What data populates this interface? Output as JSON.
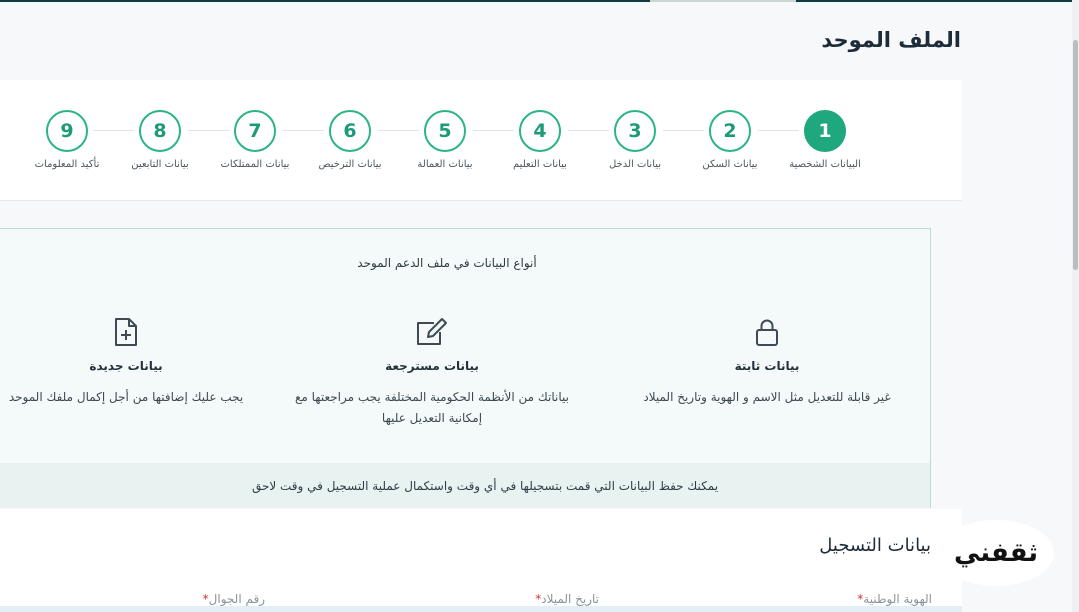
{
  "page": {
    "title": "الملف الموحد"
  },
  "stepper": {
    "steps": [
      {
        "number": "1",
        "label": "البيانات الشخصية",
        "active": true
      },
      {
        "number": "2",
        "label": "بيانات السكن"
      },
      {
        "number": "3",
        "label": "بيانات الدخل"
      },
      {
        "number": "4",
        "label": "بيانات التعليم"
      },
      {
        "number": "5",
        "label": "بيانات العمالة"
      },
      {
        "number": "6",
        "label": "بيانات الترخيص"
      },
      {
        "number": "7",
        "label": "بيانات الممتلكات"
      },
      {
        "number": "8",
        "label": "بيانات التابعين"
      },
      {
        "number": "9",
        "label": "تأكيد المعلومات"
      }
    ]
  },
  "info": {
    "title": "أنواع البيانات في ملف الدعم الموحد",
    "columns": [
      {
        "icon": "lock-icon",
        "heading": "بيانات ثابتة",
        "description": "غير قابلة للتعديل مثل الاسم و الهوية وتاريخ الميلاد"
      },
      {
        "icon": "edit-icon",
        "heading": "بيانات مسترجعة",
        "description": "بياناتك من الأنظمة الحكومية المختلفة يجب مراجعتها مع إمكانية التعديل عليها"
      },
      {
        "icon": "add-file-icon",
        "heading": "بيانات جديدة",
        "description": "يجب عليك إضافتها من أجل إكمال ملفك الموحد"
      }
    ],
    "footer": "يمكنك حفظ البيانات التي قمت بتسجيلها في أي وقت واستكمال عملية التسجيل في وقت لاحق"
  },
  "registration": {
    "title": "بيانات التسجيل",
    "fields": [
      {
        "label": "الهوية الوطنية",
        "required": "*"
      },
      {
        "label": "تاريخ الميلاد",
        "required": "*"
      },
      {
        "label": "رقم الجوال",
        "required": "*"
      }
    ]
  },
  "watermark": {
    "text": "ثقفني"
  },
  "colors": {
    "accent": "#1fa77d",
    "info_border": "#b9dcd6",
    "info_bg": "#f3faf9",
    "required": "#d0342c"
  }
}
